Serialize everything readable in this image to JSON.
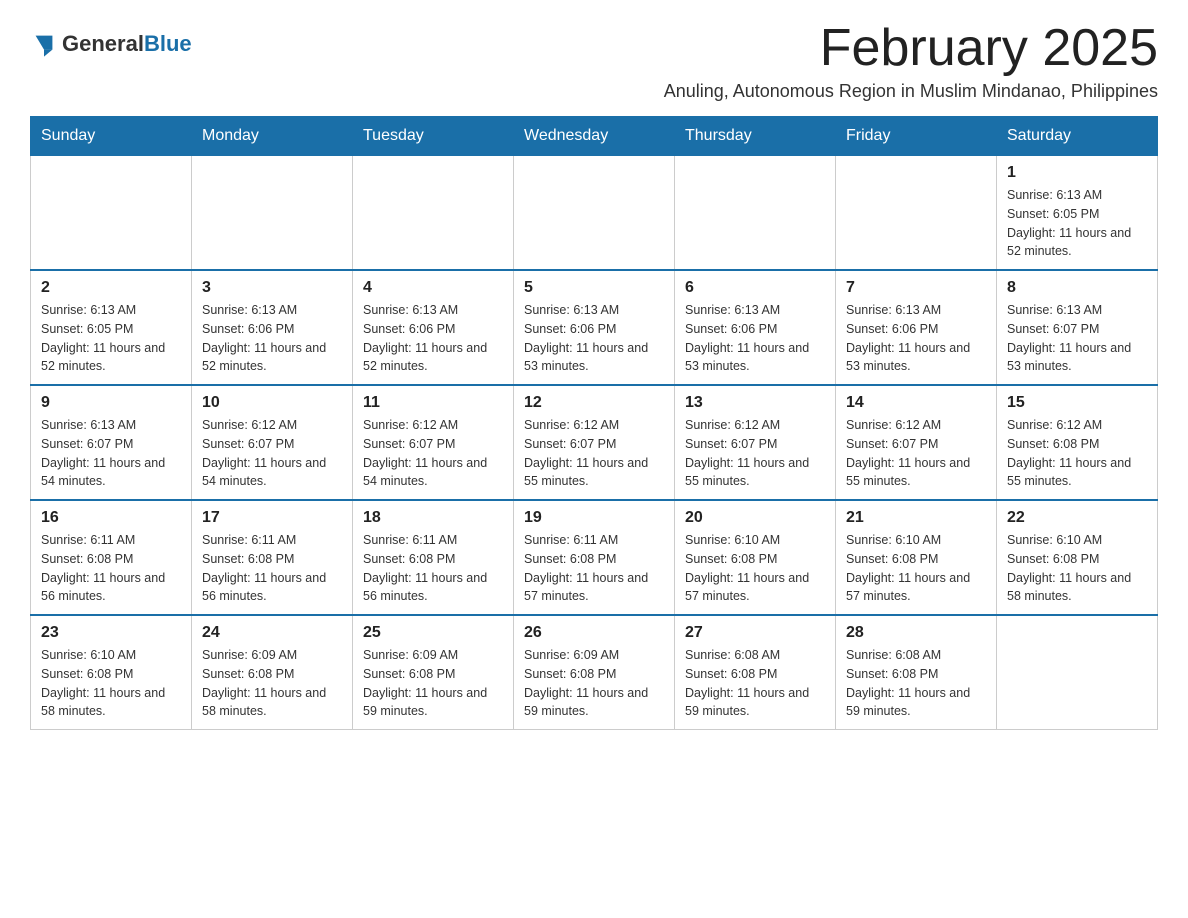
{
  "header": {
    "logo_general": "General",
    "logo_blue": "Blue",
    "month_title": "February 2025",
    "subtitle": "Anuling, Autonomous Region in Muslim Mindanao, Philippines"
  },
  "weekdays": [
    "Sunday",
    "Monday",
    "Tuesday",
    "Wednesday",
    "Thursday",
    "Friday",
    "Saturday"
  ],
  "weeks": [
    [
      {
        "day": "",
        "empty": true
      },
      {
        "day": "",
        "empty": true
      },
      {
        "day": "",
        "empty": true
      },
      {
        "day": "",
        "empty": true
      },
      {
        "day": "",
        "empty": true
      },
      {
        "day": "",
        "empty": true
      },
      {
        "day": "1",
        "sunrise": "Sunrise: 6:13 AM",
        "sunset": "Sunset: 6:05 PM",
        "daylight": "Daylight: 11 hours and 52 minutes."
      }
    ],
    [
      {
        "day": "2",
        "sunrise": "Sunrise: 6:13 AM",
        "sunset": "Sunset: 6:05 PM",
        "daylight": "Daylight: 11 hours and 52 minutes."
      },
      {
        "day": "3",
        "sunrise": "Sunrise: 6:13 AM",
        "sunset": "Sunset: 6:06 PM",
        "daylight": "Daylight: 11 hours and 52 minutes."
      },
      {
        "day": "4",
        "sunrise": "Sunrise: 6:13 AM",
        "sunset": "Sunset: 6:06 PM",
        "daylight": "Daylight: 11 hours and 52 minutes."
      },
      {
        "day": "5",
        "sunrise": "Sunrise: 6:13 AM",
        "sunset": "Sunset: 6:06 PM",
        "daylight": "Daylight: 11 hours and 53 minutes."
      },
      {
        "day": "6",
        "sunrise": "Sunrise: 6:13 AM",
        "sunset": "Sunset: 6:06 PM",
        "daylight": "Daylight: 11 hours and 53 minutes."
      },
      {
        "day": "7",
        "sunrise": "Sunrise: 6:13 AM",
        "sunset": "Sunset: 6:06 PM",
        "daylight": "Daylight: 11 hours and 53 minutes."
      },
      {
        "day": "8",
        "sunrise": "Sunrise: 6:13 AM",
        "sunset": "Sunset: 6:07 PM",
        "daylight": "Daylight: 11 hours and 53 minutes."
      }
    ],
    [
      {
        "day": "9",
        "sunrise": "Sunrise: 6:13 AM",
        "sunset": "Sunset: 6:07 PM",
        "daylight": "Daylight: 11 hours and 54 minutes."
      },
      {
        "day": "10",
        "sunrise": "Sunrise: 6:12 AM",
        "sunset": "Sunset: 6:07 PM",
        "daylight": "Daylight: 11 hours and 54 minutes."
      },
      {
        "day": "11",
        "sunrise": "Sunrise: 6:12 AM",
        "sunset": "Sunset: 6:07 PM",
        "daylight": "Daylight: 11 hours and 54 minutes."
      },
      {
        "day": "12",
        "sunrise": "Sunrise: 6:12 AM",
        "sunset": "Sunset: 6:07 PM",
        "daylight": "Daylight: 11 hours and 55 minutes."
      },
      {
        "day": "13",
        "sunrise": "Sunrise: 6:12 AM",
        "sunset": "Sunset: 6:07 PM",
        "daylight": "Daylight: 11 hours and 55 minutes."
      },
      {
        "day": "14",
        "sunrise": "Sunrise: 6:12 AM",
        "sunset": "Sunset: 6:07 PM",
        "daylight": "Daylight: 11 hours and 55 minutes."
      },
      {
        "day": "15",
        "sunrise": "Sunrise: 6:12 AM",
        "sunset": "Sunset: 6:08 PM",
        "daylight": "Daylight: 11 hours and 55 minutes."
      }
    ],
    [
      {
        "day": "16",
        "sunrise": "Sunrise: 6:11 AM",
        "sunset": "Sunset: 6:08 PM",
        "daylight": "Daylight: 11 hours and 56 minutes."
      },
      {
        "day": "17",
        "sunrise": "Sunrise: 6:11 AM",
        "sunset": "Sunset: 6:08 PM",
        "daylight": "Daylight: 11 hours and 56 minutes."
      },
      {
        "day": "18",
        "sunrise": "Sunrise: 6:11 AM",
        "sunset": "Sunset: 6:08 PM",
        "daylight": "Daylight: 11 hours and 56 minutes."
      },
      {
        "day": "19",
        "sunrise": "Sunrise: 6:11 AM",
        "sunset": "Sunset: 6:08 PM",
        "daylight": "Daylight: 11 hours and 57 minutes."
      },
      {
        "day": "20",
        "sunrise": "Sunrise: 6:10 AM",
        "sunset": "Sunset: 6:08 PM",
        "daylight": "Daylight: 11 hours and 57 minutes."
      },
      {
        "day": "21",
        "sunrise": "Sunrise: 6:10 AM",
        "sunset": "Sunset: 6:08 PM",
        "daylight": "Daylight: 11 hours and 57 minutes."
      },
      {
        "day": "22",
        "sunrise": "Sunrise: 6:10 AM",
        "sunset": "Sunset: 6:08 PM",
        "daylight": "Daylight: 11 hours and 58 minutes."
      }
    ],
    [
      {
        "day": "23",
        "sunrise": "Sunrise: 6:10 AM",
        "sunset": "Sunset: 6:08 PM",
        "daylight": "Daylight: 11 hours and 58 minutes."
      },
      {
        "day": "24",
        "sunrise": "Sunrise: 6:09 AM",
        "sunset": "Sunset: 6:08 PM",
        "daylight": "Daylight: 11 hours and 58 minutes."
      },
      {
        "day": "25",
        "sunrise": "Sunrise: 6:09 AM",
        "sunset": "Sunset: 6:08 PM",
        "daylight": "Daylight: 11 hours and 59 minutes."
      },
      {
        "day": "26",
        "sunrise": "Sunrise: 6:09 AM",
        "sunset": "Sunset: 6:08 PM",
        "daylight": "Daylight: 11 hours and 59 minutes."
      },
      {
        "day": "27",
        "sunrise": "Sunrise: 6:08 AM",
        "sunset": "Sunset: 6:08 PM",
        "daylight": "Daylight: 11 hours and 59 minutes."
      },
      {
        "day": "28",
        "sunrise": "Sunrise: 6:08 AM",
        "sunset": "Sunset: 6:08 PM",
        "daylight": "Daylight: 11 hours and 59 minutes."
      },
      {
        "day": "",
        "empty": true
      }
    ]
  ]
}
